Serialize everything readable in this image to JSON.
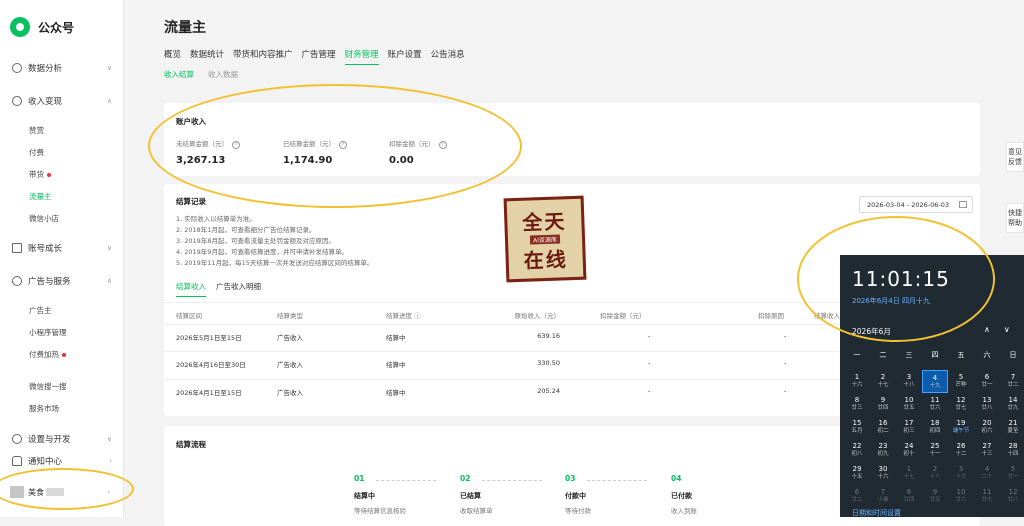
{
  "app": {
    "name": "公众号"
  },
  "sidebar": {
    "groups": [
      {
        "label": "数据分析"
      },
      {
        "label": "收入变现"
      },
      {
        "label": "账号成长"
      },
      {
        "label": "广告与服务"
      },
      {
        "label": "设置与开发"
      },
      {
        "label": "通知中心"
      }
    ],
    "income_items": [
      "赞赏",
      "付费",
      "带货",
      "流量主",
      "微信小店"
    ],
    "ad_items": [
      "广告主",
      "小程序管理",
      "付费加热",
      "微信搜一搜",
      "服务市场"
    ],
    "account_name": "美食"
  },
  "page": {
    "title": "流量主",
    "tabs": [
      "概览",
      "数据统计",
      "带货和内容推广",
      "广告管理",
      "财务管理",
      "账户设置",
      "公告消息"
    ],
    "subtabs": [
      "收入结算",
      "收入数据"
    ]
  },
  "account_income": {
    "title": "账户收入",
    "stats": [
      {
        "label": "未结算金额（元）",
        "value": "3,267.13"
      },
      {
        "label": "已结算金额（元）",
        "value": "1,174.90"
      },
      {
        "label": "扣除金额（元）",
        "value": "0.00"
      }
    ]
  },
  "settlement": {
    "title": "结算记录",
    "date_range": "2026-03-04 - 2026-06-03",
    "notes": [
      "1. 实际收入以结算单为准。",
      "2. 2018年1月起，可查看细分广告位结算记录。",
      "3. 2019年8月起，可查看流量主处罚金额及对应原因。",
      "4. 2019年9月起，可查看结算进度，并可申请补发结算单。",
      "5. 2019年11月起，每15天结算一次并发送对应结算区间的结算单。"
    ],
    "tabs": [
      "结算收入",
      "广告收入明细"
    ],
    "columns": [
      "结算区间",
      "结算类型",
      "结算进度",
      "原始收入（元）",
      "扣除金额（元）",
      "扣除原因",
      "结算收入"
    ],
    "rows": [
      {
        "period": "2026年5月1日至15日",
        "type": "广告收入",
        "status": "结算中",
        "original": "639.16",
        "deduct": "-",
        "reason": "-"
      },
      {
        "period": "2026年4月16日至30日",
        "type": "广告收入",
        "status": "结算中",
        "original": "330.50",
        "deduct": "-",
        "reason": "-"
      },
      {
        "period": "2026年4月1日至15日",
        "type": "广告收入",
        "status": "结算中",
        "original": "205.24",
        "deduct": "-",
        "reason": "-"
      }
    ]
  },
  "stamp": {
    "line1": "全天",
    "line2": "在线",
    "middle": "AI资源库"
  },
  "flow": {
    "title": "结算流程",
    "steps": [
      {
        "num": "01",
        "title": "结算中",
        "desc": "等待结算信息核验"
      },
      {
        "num": "02",
        "title": "已结算",
        "desc": "收取结算单"
      },
      {
        "num": "03",
        "title": "付款中",
        "desc": "等待付款"
      },
      {
        "num": "04",
        "title": "已付款",
        "desc": "收入到账"
      }
    ]
  },
  "feedback": [
    "意见反馈",
    "快捷帮助"
  ],
  "clock": {
    "time": "11:01:15",
    "date": "2026年6月4日 四月十九",
    "month": "2026年6月",
    "weekdays": [
      "一",
      "二",
      "三",
      "四",
      "五",
      "六",
      "日"
    ],
    "days": [
      {
        "d": "1",
        "l": "十六"
      },
      {
        "d": "2",
        "l": "十七"
      },
      {
        "d": "3",
        "l": "十八"
      },
      {
        "d": "4",
        "l": "十九"
      },
      {
        "d": "5",
        "l": "芒种"
      },
      {
        "d": "6",
        "l": "廿一"
      },
      {
        "d": "7",
        "l": "廿二"
      },
      {
        "d": "8",
        "l": "廿三"
      },
      {
        "d": "9",
        "l": "廿四"
      },
      {
        "d": "10",
        "l": "廿五"
      },
      {
        "d": "11",
        "l": "廿六"
      },
      {
        "d": "12",
        "l": "廿七"
      },
      {
        "d": "13",
        "l": "廿八"
      },
      {
        "d": "14",
        "l": "廿九"
      },
      {
        "d": "15",
        "l": "五月"
      },
      {
        "d": "16",
        "l": "初二"
      },
      {
        "d": "17",
        "l": "初三"
      },
      {
        "d": "18",
        "l": "初四"
      },
      {
        "d": "19",
        "l": "端午节"
      },
      {
        "d": "20",
        "l": "初六"
      },
      {
        "d": "21",
        "l": "夏至"
      },
      {
        "d": "22",
        "l": "初八"
      },
      {
        "d": "23",
        "l": "初九"
      },
      {
        "d": "24",
        "l": "初十"
      },
      {
        "d": "25",
        "l": "十一"
      },
      {
        "d": "26",
        "l": "十二"
      },
      {
        "d": "27",
        "l": "十三"
      },
      {
        "d": "28",
        "l": "十四"
      },
      {
        "d": "29",
        "l": "十五"
      },
      {
        "d": "30",
        "l": "十六"
      },
      {
        "d": "1",
        "l": "十七"
      },
      {
        "d": "2",
        "l": "十八"
      },
      {
        "d": "3",
        "l": "十九"
      },
      {
        "d": "4",
        "l": "二十"
      },
      {
        "d": "5",
        "l": "廿一"
      },
      {
        "d": "6",
        "l": "廿二"
      },
      {
        "d": "7",
        "l": "小暑"
      },
      {
        "d": "8",
        "l": "廿四"
      },
      {
        "d": "9",
        "l": "廿五"
      },
      {
        "d": "10",
        "l": "廿六"
      },
      {
        "d": "11",
        "l": "廿七"
      },
      {
        "d": "12",
        "l": "廿八"
      }
    ],
    "selected": "4",
    "link": "日期和时间设置"
  },
  "colors": {
    "accent": "#07c160",
    "highlight": "#f2c12e",
    "clock_bg": "#1f2a33"
  }
}
